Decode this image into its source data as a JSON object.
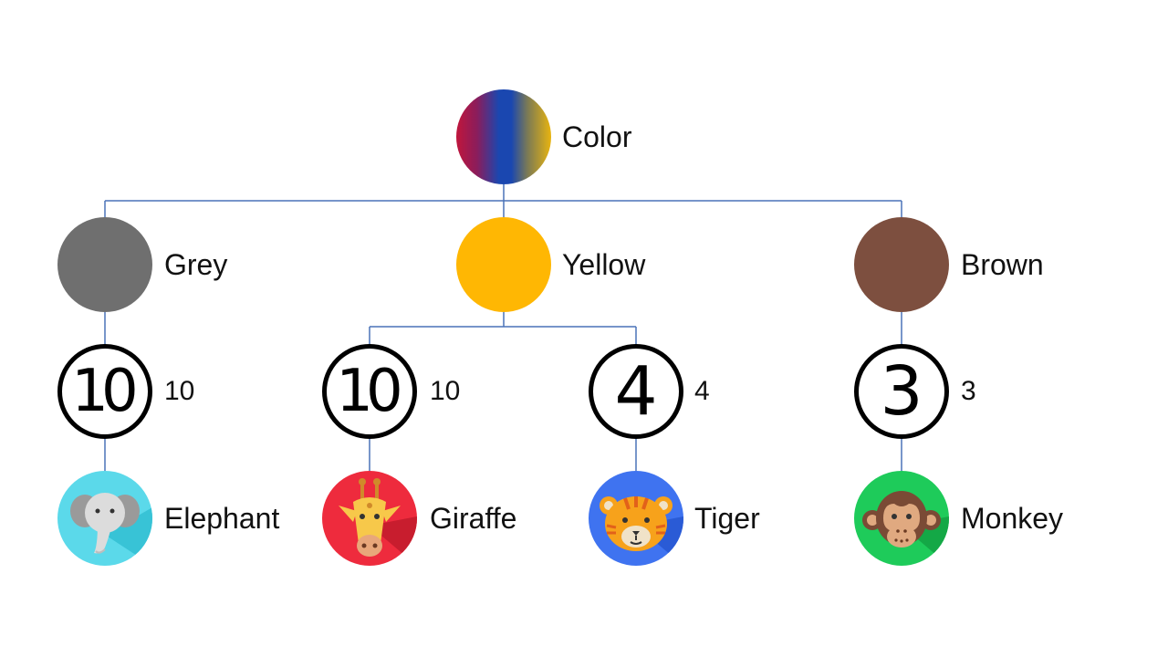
{
  "root": {
    "label": "Color",
    "gradient": [
      "#c0163c",
      "#1a47b0",
      "#e8b410"
    ]
  },
  "colors": [
    {
      "id": "grey",
      "label": "Grey",
      "color": "#6f6f6f"
    },
    {
      "id": "yellow",
      "label": "Yellow",
      "color": "#ffb703"
    },
    {
      "id": "brown",
      "label": "Brown",
      "color": "#7d4f3f"
    }
  ],
  "counts": [
    {
      "id": "grey-count",
      "value": "10",
      "label": "10"
    },
    {
      "id": "giraffe-count",
      "value": "10",
      "label": "10"
    },
    {
      "id": "tiger-count",
      "value": "4",
      "label": "4"
    },
    {
      "id": "monkey-count",
      "value": "3",
      "label": "3"
    }
  ],
  "animals": [
    {
      "id": "elephant",
      "label": "Elephant",
      "bg": "#5bd9ea",
      "icon": "elephant-icon"
    },
    {
      "id": "giraffe",
      "label": "Giraffe",
      "bg": "#ee2b3d",
      "icon": "giraffe-icon"
    },
    {
      "id": "tiger",
      "label": "Tiger",
      "bg": "#3f73f0",
      "icon": "tiger-icon"
    },
    {
      "id": "monkey",
      "label": "Monkey",
      "bg": "#1ecb5a",
      "icon": "monkey-icon"
    }
  ],
  "connector_color": "#4a72b8"
}
